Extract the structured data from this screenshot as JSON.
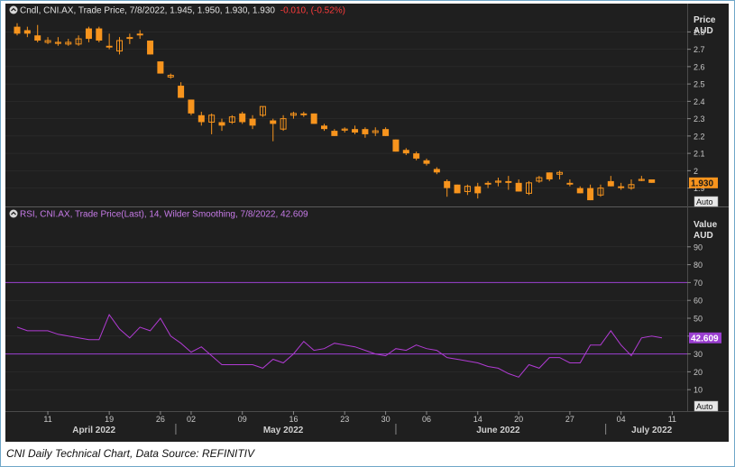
{
  "caption": "CNI Daily Technical Chart, Data Source: REFINITIV",
  "colors": {
    "background": "#1f1f1f",
    "candle": "#f7941d",
    "price_header": "#e0e0e0",
    "change_negative": "#ff3b3b",
    "rsi_line": "#b13bd4",
    "rsi_header": "#c77be8",
    "rsi_level": "#9b3fd1",
    "axis_text": "#c8c8c8",
    "grid": "#333333"
  },
  "price_panel": {
    "legend_icon": "collapse-circle-icon",
    "legend_text": "Cndl, CNI.AX, Trade Price, 7/8/2022, 1.945, 1.950, 1.930, 1.930",
    "legend_change": "-0.010, (-0.52%)",
    "axis_title_1": "Price",
    "axis_title_2": "AUD",
    "last_price_label": "1.930",
    "auto_label": "Auto"
  },
  "rsi_panel": {
    "legend_icon": "collapse-circle-icon",
    "legend_text": "RSI, CNI.AX, Trade Price(Last), 14, Wilder Smoothing, 7/8/2022, 42.609",
    "axis_title_1": "Value",
    "axis_title_2": "AUD",
    "last_value_label": "42.609",
    "auto_label": "Auto"
  },
  "x_axis": {
    "day_ticks": [
      "11",
      "19",
      "26",
      "02",
      "09",
      "16",
      "23",
      "30",
      "06",
      "14",
      "20",
      "27",
      "04",
      "11"
    ],
    "months": [
      "April 2022",
      "May 2022",
      "June 2022",
      "July 2022"
    ]
  },
  "chart_data": [
    {
      "type": "candlestick",
      "title": "Cndl, CNI.AX, Trade Price",
      "ylabel": "Price AUD",
      "ylim": [
        1.82,
        2.88
      ],
      "yticks": [
        1.9,
        2,
        2.1,
        2.2,
        2.3,
        2.4,
        2.5,
        2.6,
        2.7,
        2.8
      ],
      "ohlc": [
        [
          2.83,
          2.85,
          2.78,
          2.79
        ],
        [
          2.81,
          2.83,
          2.77,
          2.79
        ],
        [
          2.78,
          2.84,
          2.74,
          2.75
        ],
        [
          2.74,
          2.77,
          2.73,
          2.75
        ],
        [
          2.74,
          2.77,
          2.72,
          2.74
        ],
        [
          2.73,
          2.76,
          2.72,
          2.74
        ],
        [
          2.73,
          2.78,
          2.72,
          2.76
        ],
        [
          2.82,
          2.83,
          2.74,
          2.76
        ],
        [
          2.82,
          2.83,
          2.74,
          2.75
        ],
        [
          2.72,
          2.79,
          2.7,
          2.71
        ],
        [
          2.69,
          2.77,
          2.67,
          2.75
        ],
        [
          2.77,
          2.79,
          2.73,
          2.76
        ],
        [
          2.79,
          2.81,
          2.76,
          2.78
        ],
        [
          2.75,
          2.75,
          2.67,
          2.67
        ],
        [
          2.63,
          2.63,
          2.56,
          2.56
        ],
        [
          2.54,
          2.56,
          2.53,
          2.55
        ],
        [
          2.49,
          2.51,
          2.42,
          2.42
        ],
        [
          2.41,
          2.41,
          2.32,
          2.33
        ],
        [
          2.32,
          2.34,
          2.26,
          2.28
        ],
        [
          2.28,
          2.33,
          2.21,
          2.32
        ],
        [
          2.28,
          2.3,
          2.23,
          2.26
        ],
        [
          2.28,
          2.32,
          2.27,
          2.31
        ],
        [
          2.33,
          2.34,
          2.27,
          2.28
        ],
        [
          2.3,
          2.32,
          2.24,
          2.26
        ],
        [
          2.32,
          2.37,
          2.31,
          2.37
        ],
        [
          2.29,
          2.3,
          2.17,
          2.27
        ],
        [
          2.24,
          2.32,
          2.23,
          2.3
        ],
        [
          2.32,
          2.34,
          2.3,
          2.33
        ],
        [
          2.33,
          2.34,
          2.31,
          2.32
        ],
        [
          2.33,
          2.33,
          2.27,
          2.27
        ],
        [
          2.26,
          2.27,
          2.23,
          2.24
        ],
        [
          2.23,
          2.24,
          2.2,
          2.2
        ],
        [
          2.24,
          2.25,
          2.22,
          2.24
        ],
        [
          2.24,
          2.26,
          2.21,
          2.22
        ],
        [
          2.24,
          2.25,
          2.19,
          2.21
        ],
        [
          2.22,
          2.25,
          2.2,
          2.23
        ],
        [
          2.24,
          2.25,
          2.2,
          2.2
        ],
        [
          2.18,
          2.18,
          2.11,
          2.11
        ],
        [
          2.12,
          2.13,
          2.09,
          2.1
        ],
        [
          2.1,
          2.11,
          2.06,
          2.07
        ],
        [
          2.06,
          2.07,
          2.03,
          2.04
        ],
        [
          2.01,
          2.02,
          1.98,
          1.99
        ],
        [
          1.94,
          1.95,
          1.85,
          1.9
        ],
        [
          1.92,
          1.92,
          1.87,
          1.87
        ],
        [
          1.88,
          1.92,
          1.86,
          1.91
        ],
        [
          1.91,
          1.93,
          1.84,
          1.87
        ],
        [
          1.93,
          1.94,
          1.9,
          1.92
        ],
        [
          1.94,
          1.96,
          1.91,
          1.94
        ],
        [
          1.94,
          1.97,
          1.89,
          1.93
        ],
        [
          1.93,
          1.95,
          1.88,
          1.88
        ],
        [
          1.87,
          1.94,
          1.86,
          1.93
        ],
        [
          1.94,
          1.97,
          1.93,
          1.96
        ],
        [
          1.99,
          1.99,
          1.94,
          1.95
        ],
        [
          1.98,
          2.0,
          1.95,
          1.99
        ],
        [
          1.93,
          1.95,
          1.91,
          1.92
        ],
        [
          1.9,
          1.91,
          1.87,
          1.87
        ],
        [
          1.9,
          1.92,
          1.83,
          1.83
        ],
        [
          1.86,
          1.92,
          1.85,
          1.9
        ],
        [
          1.94,
          1.97,
          1.91,
          1.91
        ],
        [
          1.91,
          1.93,
          1.89,
          1.9
        ],
        [
          1.9,
          1.95,
          1.89,
          1.92
        ],
        [
          1.95,
          1.97,
          1.94,
          1.95
        ],
        [
          1.95,
          1.95,
          1.93,
          1.93
        ]
      ]
    },
    {
      "type": "line",
      "title": "RSI, CNI.AX, Trade Price(Last), 14, Wilder Smoothing",
      "ylabel": "Value AUD",
      "ylim": [
        0,
        100
      ],
      "yticks": [
        10,
        20,
        30,
        40,
        50,
        60,
        70,
        80,
        90
      ],
      "levels": [
        70,
        30
      ],
      "series": [
        {
          "values": [
            45,
            43,
            43,
            43,
            41,
            40,
            39,
            38,
            38,
            52,
            44,
            39,
            45,
            43,
            50,
            40,
            36,
            31,
            34,
            29,
            24,
            24,
            24,
            24,
            22,
            27,
            25,
            30,
            37,
            32,
            33,
            36,
            35,
            34,
            32,
            30,
            29,
            33,
            32,
            35,
            33,
            32,
            28,
            27,
            26,
            25,
            23,
            22,
            19,
            17,
            24,
            22,
            28,
            28,
            25,
            25,
            35,
            35,
            43,
            35,
            29,
            39,
            40,
            39
          ]
        }
      ]
    }
  ]
}
